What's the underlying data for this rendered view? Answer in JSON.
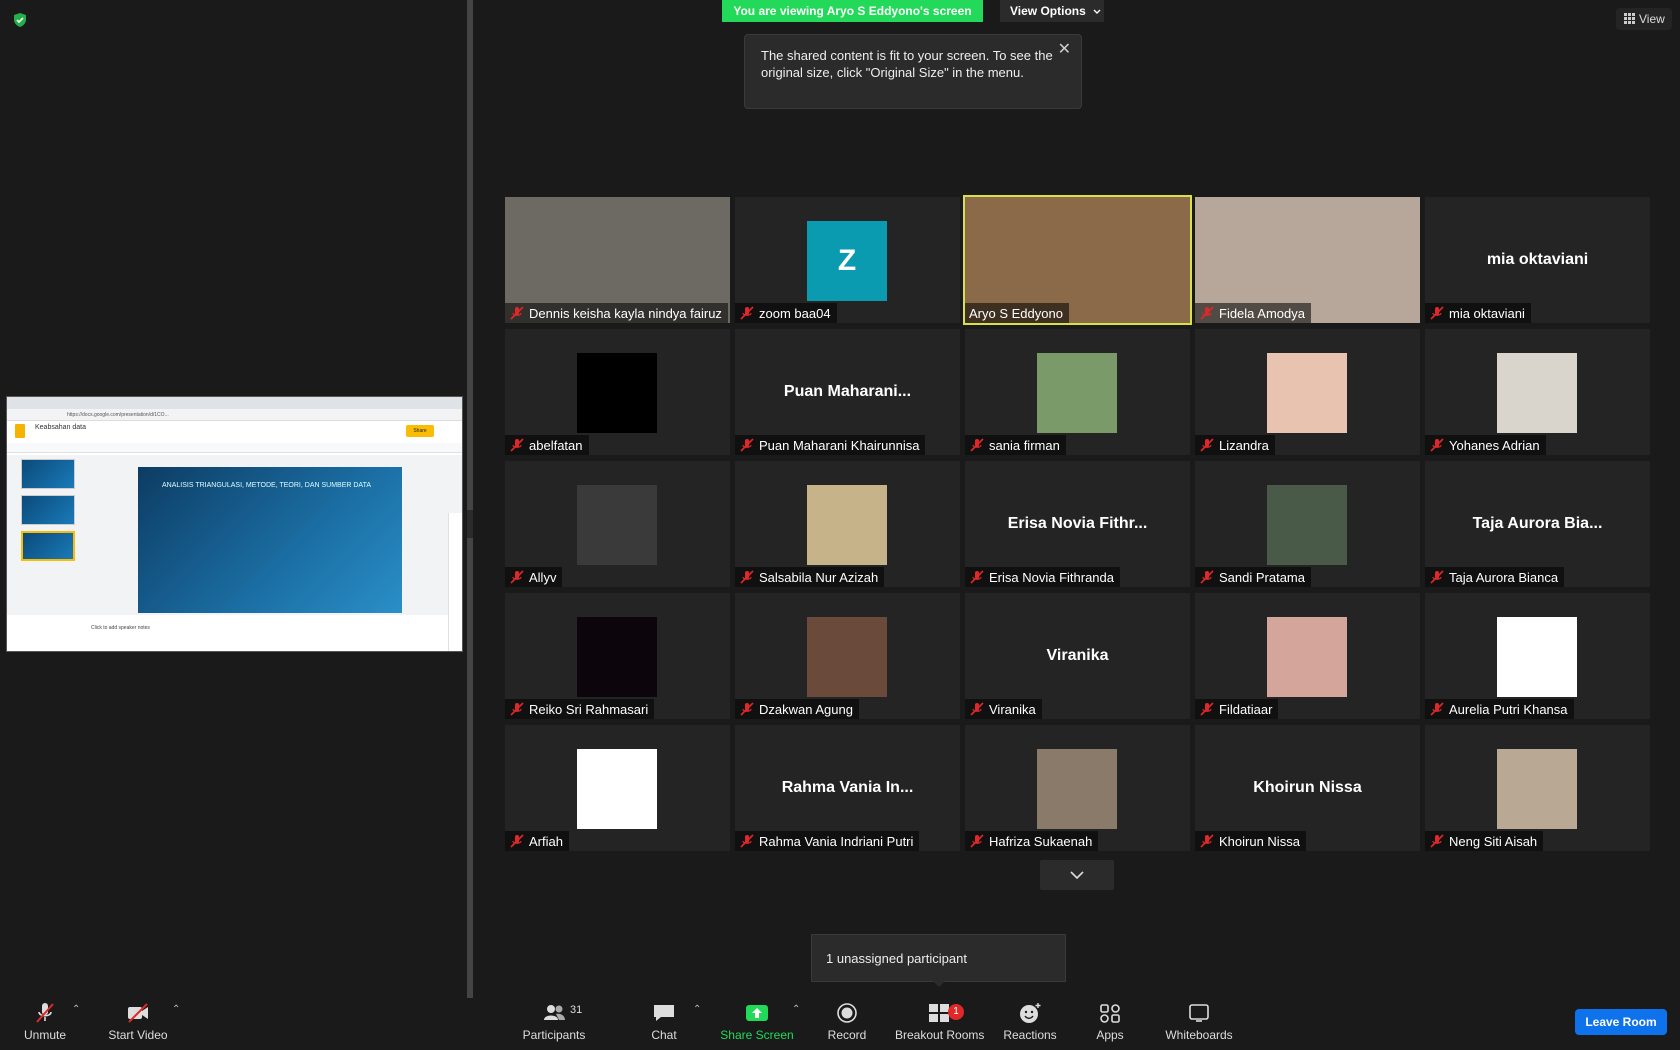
{
  "banner": {
    "text": "You are viewing Aryo S Eddyono's screen",
    "view_options": "View Options"
  },
  "view_button": "View",
  "tooltip": {
    "line1": "The shared content is fit to your screen. To see the",
    "line2": "original size, click \"Original Size\" in the menu."
  },
  "share_preview": {
    "url": "https://docs.google.com/presentation/d/1CO...",
    "doc_title": "Keabsahan data",
    "share_label": "Share",
    "slide_heading": "ANALISIS TRIANGULASI, METODE, TEORI, DAN SUMBER DATA",
    "speaker_notes": "Click to add speaker notes"
  },
  "tiles": [
    {
      "name": "Dennis keisha kayla nindya fairuz",
      "kind": "video",
      "color": "#6d6a63"
    },
    {
      "name": "zoom baa04",
      "kind": "letter",
      "letter": "Z"
    },
    {
      "name": "Aryo S Eddyono",
      "kind": "video",
      "color": "#8a6a48",
      "speaking": true
    },
    {
      "name": "Fidela Amodya",
      "kind": "video",
      "color": "#b7a69a"
    },
    {
      "name": "mia oktaviani",
      "kind": "text",
      "display": "mia oktaviani"
    },
    {
      "name": "abelfatan",
      "kind": "photo",
      "color": "#000000"
    },
    {
      "name": "Puan Maharani Khairunnisa",
      "kind": "text",
      "display": "Puan  Maharani..."
    },
    {
      "name": "sania firman",
      "kind": "photo",
      "color": "#7a9a6a"
    },
    {
      "name": "Lizandra",
      "kind": "photo",
      "color": "#e8c4b0"
    },
    {
      "name": "Yohanes Adrian",
      "kind": "photo",
      "color": "#d9d4cc"
    },
    {
      "name": "Allyv",
      "kind": "photo",
      "color": "#3a3a3a"
    },
    {
      "name": "Salsabila Nur Azizah",
      "kind": "photo",
      "color": "#c7b38a"
    },
    {
      "name": "Erisa Novia Fithranda",
      "kind": "text",
      "display": "Erisa  Novia Fithr..."
    },
    {
      "name": "Sandi Pratama",
      "kind": "photo",
      "color": "#4a5a48"
    },
    {
      "name": "Taja Aurora Bianca",
      "kind": "text",
      "display": "Taja Aurora Bia..."
    },
    {
      "name": "Reiko Sri Rahmasari",
      "kind": "photo",
      "color": "#0c050c"
    },
    {
      "name": "Dzakwan Agung",
      "kind": "photo",
      "color": "#6a4a3a"
    },
    {
      "name": "Viranika",
      "kind": "text",
      "display": "Viranika"
    },
    {
      "name": "Fildatiaar",
      "kind": "photo",
      "color": "#d4a59a"
    },
    {
      "name": "Aurelia Putri Khansa",
      "kind": "photo",
      "color": "#ffffff"
    },
    {
      "name": "Arfiah",
      "kind": "photo",
      "color": "#ffffff"
    },
    {
      "name": "Rahma Vania Indriani Putri",
      "kind": "text",
      "display": "Rahma  Vania  In..."
    },
    {
      "name": "Hafriza Sukaenah",
      "kind": "photo",
      "color": "#8a7a6a"
    },
    {
      "name": "Khoirun Nissa",
      "kind": "text",
      "display": "Khoirun Nissa"
    },
    {
      "name": "Neng Siti Aisah",
      "kind": "photo",
      "color": "#b8a894"
    }
  ],
  "unassigned": "1 unassigned participant",
  "toolbar": {
    "unmute": "Unmute",
    "start_video": "Start Video",
    "participants": "Participants",
    "participants_count": "31",
    "chat": "Chat",
    "share_screen": "Share Screen",
    "record": "Record",
    "breakout_rooms": "Breakout Rooms",
    "breakout_badge": "1",
    "reactions": "Reactions",
    "apps": "Apps",
    "whiteboards": "Whiteboards",
    "leave": "Leave Room"
  },
  "colors": {
    "accent_green": "#23d959",
    "leave_blue": "#0e72ed",
    "speaker_outline": "#d7e24a",
    "muted_red": "#e02828"
  }
}
